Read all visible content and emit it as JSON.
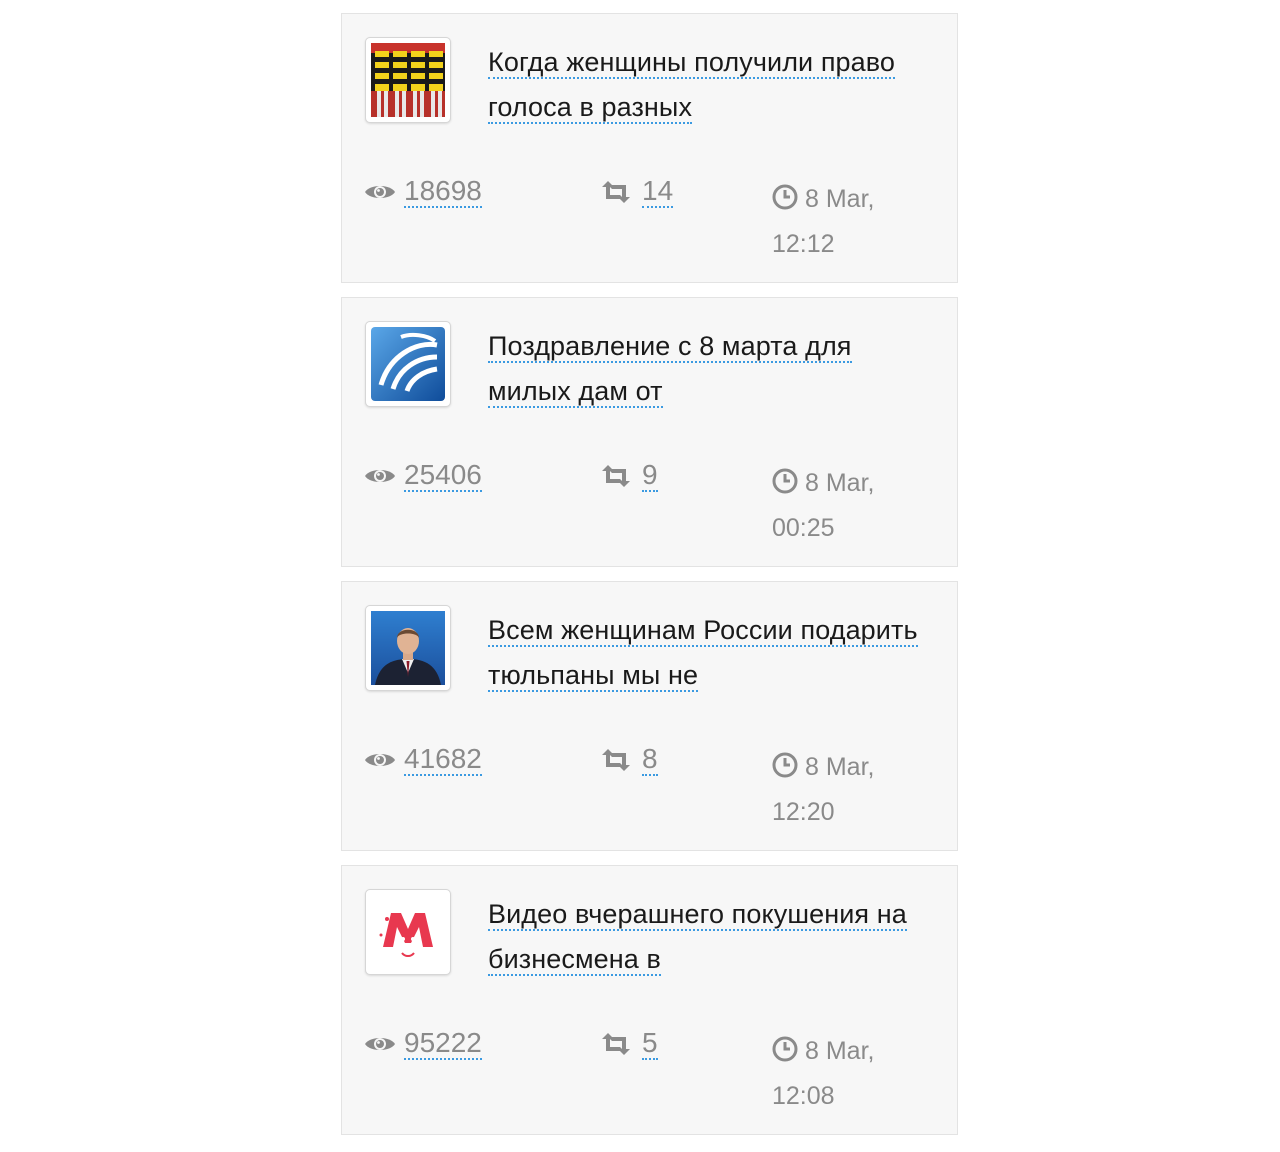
{
  "posts": [
    {
      "title": "Когда женщины получили право голоса в разных",
      "thumbnail": "bee-striped-figures-image",
      "views": "18698",
      "shares": "14",
      "date": "8 Mar,",
      "time": "12:12"
    },
    {
      "title": "Поздравление с 8 марта для милых дам от",
      "thumbnail": "blue-globe-logo",
      "views": "25406",
      "shares": "9",
      "date": "8 Mar,",
      "time": "00:25"
    },
    {
      "title": "Всем женщинам России подарить тюльпаны мы не",
      "thumbnail": "man-in-suit-portrait",
      "views": "41682",
      "shares": "8",
      "date": "8 Mar,",
      "time": "12:20"
    },
    {
      "title": "Видео вчерашнего покушения на бизнесмена в",
      "thumbnail": "red-m-logo",
      "views": "95222",
      "shares": "5",
      "date": "8 Mar,",
      "time": "12:08"
    }
  ],
  "colors": {
    "card_bg": "#f7f7f7",
    "link_underline": "#3b9ae1",
    "meta_text": "#8a8a8a"
  }
}
